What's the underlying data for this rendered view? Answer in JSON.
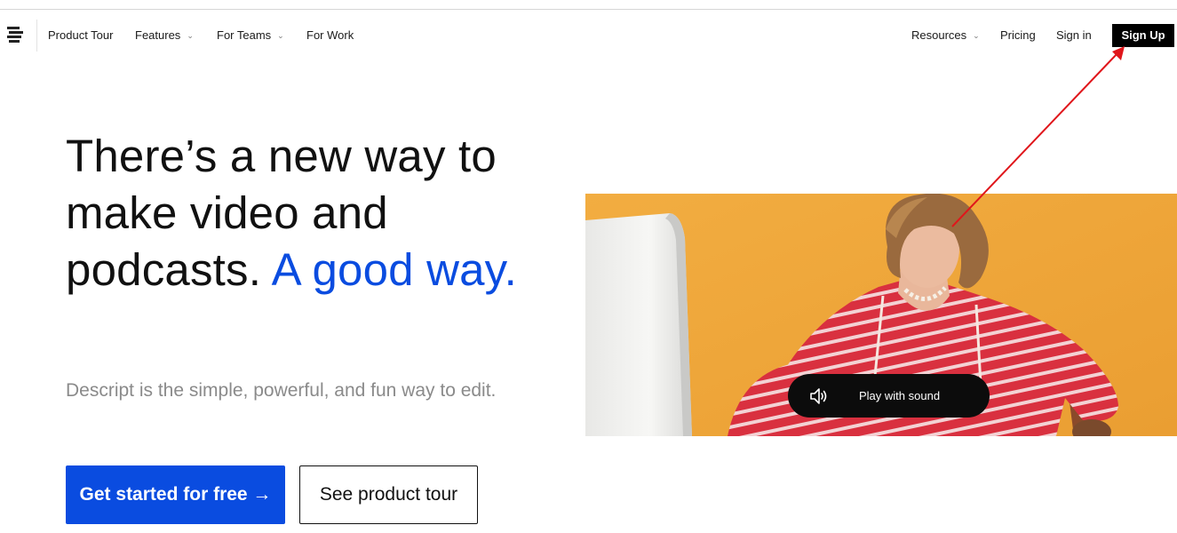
{
  "nav": {
    "items": [
      {
        "label": "Product Tour"
      },
      {
        "label": "Features"
      },
      {
        "label": "For Teams"
      },
      {
        "label": "For Work"
      }
    ],
    "right_items": [
      {
        "label": "Resources"
      },
      {
        "label": "Pricing"
      },
      {
        "label": "Sign in"
      }
    ],
    "signup_label": "Sign Up"
  },
  "hero": {
    "title_part1": "There’s a new way to make video and podcasts.",
    "title_accent": "A good way.",
    "subtitle": "Descript is the simple, powerful, and fun way to edit.",
    "primary_cta": "Get started for free →",
    "secondary_cta": "See product tour"
  },
  "video": {
    "sound_label": "Play with sound"
  },
  "colors": {
    "accent": "#0a4ce0",
    "video_background": "#efa63a",
    "annotation_arrow": "#e0161b"
  },
  "icons": {
    "logo": "descript-logo-icon",
    "chevron": "chevron-down-icon",
    "sound": "speaker-icon"
  }
}
